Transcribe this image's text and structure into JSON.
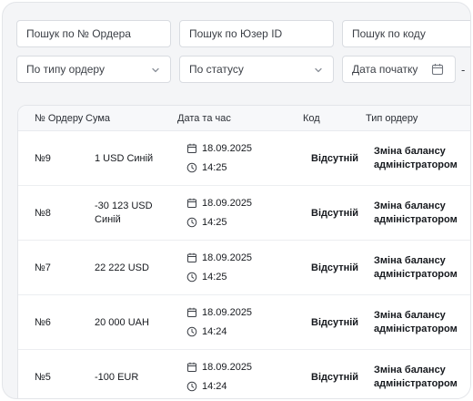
{
  "filters": {
    "order_search_placeholder": "Пошук по № Ордера",
    "user_search_placeholder": "Пошук по Юзер ID",
    "code_search_placeholder": "Пошук по коду",
    "order_type_select": "По типу ордеру",
    "status_select": "По статусу",
    "start_date_label": "Дата початку",
    "range_separator": "-"
  },
  "table": {
    "headers": {
      "order_no": "№ Ордеру",
      "amount": "Сума",
      "datetime": "Дата та час",
      "code": "Код",
      "order_type": "Тип ордеру"
    },
    "rows": [
      {
        "order_no": "№9",
        "amount": [
          "1 USD Синій"
        ],
        "date": "18.09.2025",
        "time": "14:25",
        "code": "Відсутній",
        "order_type": [
          "Зміна балансу",
          "адміністратором"
        ]
      },
      {
        "order_no": "№8",
        "amount": [
          "-30 123 USD",
          "Синій"
        ],
        "date": "18.09.2025",
        "time": "14:25",
        "code": "Відсутній",
        "order_type": [
          "Зміна балансу",
          "адміністратором"
        ]
      },
      {
        "order_no": "№7",
        "amount": [
          "22 222 USD"
        ],
        "date": "18.09.2025",
        "time": "14:25",
        "code": "Відсутній",
        "order_type": [
          "Зміна балансу",
          "адміністратором"
        ]
      },
      {
        "order_no": "№6",
        "amount": [
          "20 000 UAH"
        ],
        "date": "18.09.2025",
        "time": "14:24",
        "code": "Відсутній",
        "order_type": [
          "Зміна балансу",
          "адміністратором"
        ]
      },
      {
        "order_no": "№5",
        "amount": [
          "-100 EUR"
        ],
        "date": "18.09.2025",
        "time": "14:24",
        "code": "Відсутній",
        "order_type": [
          "Зміна балансу",
          "адміністратором"
        ]
      }
    ]
  },
  "icons": {
    "select_arrow": "chevron-down-icon",
    "date_picker": "calendar-icon",
    "row_date": "calendar-icon",
    "row_time": "clock-icon"
  }
}
